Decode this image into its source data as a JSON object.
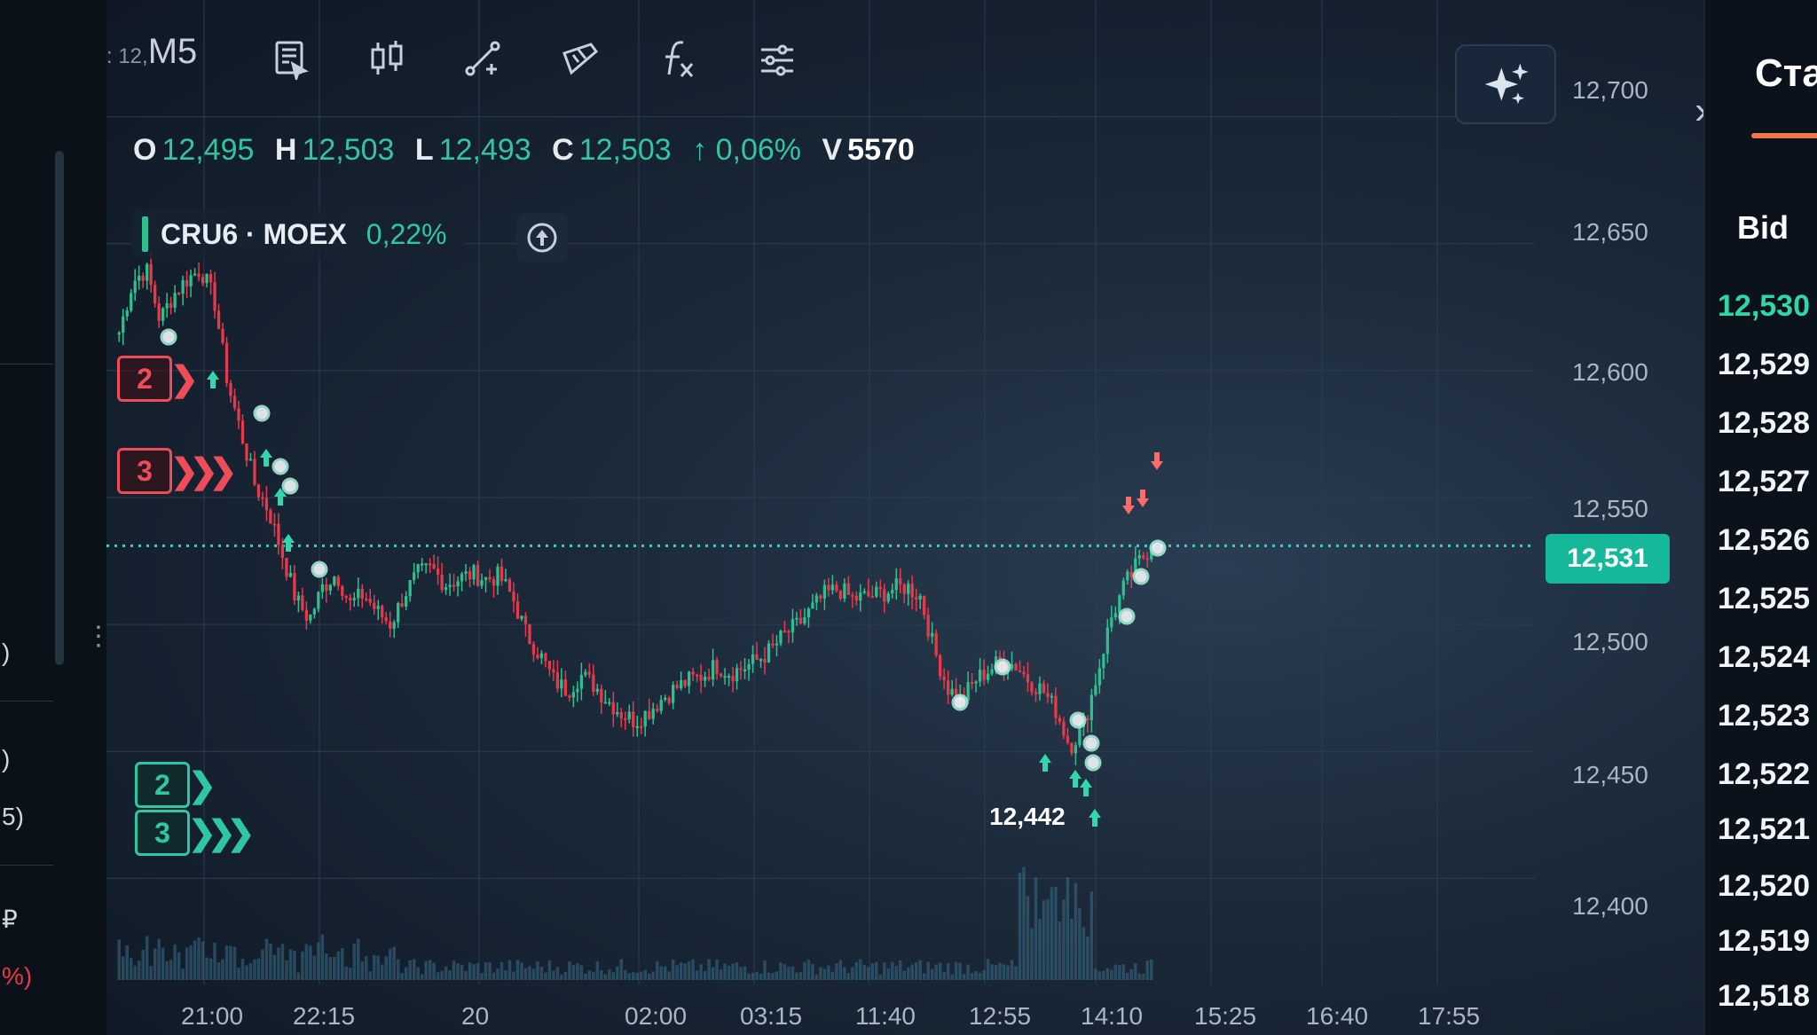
{
  "toolbar": {
    "interval_prefix": ": 12,",
    "interval": "M5",
    "tools": [
      {
        "name": "layout-icon"
      },
      {
        "name": "candles-icon"
      },
      {
        "name": "draw-icon"
      },
      {
        "name": "brush-icon"
      },
      {
        "name": "indicators-icon"
      },
      {
        "name": "settings-icon"
      }
    ],
    "ai_icon": "sparkles-icon"
  },
  "ohlc": {
    "o_label": "O",
    "o": "12,495",
    "h_label": "H",
    "h": "12,503",
    "l_label": "L",
    "l": "12,493",
    "c_label": "C",
    "c": "12,503",
    "change": "↑ 0,06%",
    "v_label": "V",
    "v": "5570"
  },
  "symbol": {
    "name": "CRU6 · MOEX",
    "change": "0,22%"
  },
  "level_tags": {
    "sell": [
      "2",
      "3"
    ],
    "buy": [
      "2",
      "3"
    ]
  },
  "price_axis": {
    "ticks": [
      "12,700",
      "12,650",
      "12,600",
      "12,550",
      "12,500",
      "12,450",
      "12,400"
    ],
    "current_price": "12,531"
  },
  "time_axis": {
    "ticks": [
      "21:00",
      "22:15",
      "20",
      "02:00",
      "03:15",
      "11:40",
      "12:55",
      "14:10",
      "15:25",
      "16:40",
      "17:55"
    ]
  },
  "chart_annotations": {
    "low_label": "12,442"
  },
  "orderbook": {
    "title": "Ста",
    "bid_label": "Bid",
    "rows": [
      "12,530",
      "12,529",
      "12,528",
      "12,527",
      "12,526",
      "12,525",
      "12,524",
      "12,523",
      "12,522",
      "12,521",
      "12,520",
      "12,519",
      "12,518"
    ]
  },
  "left_panel": {
    "fragments": [
      ")",
      ")",
      "5)",
      "₽",
      "%)"
    ]
  },
  "colors": {
    "up": "#2fbf8f",
    "down": "#e8394a",
    "accent": "#16b89a",
    "background": "#1a2838"
  },
  "chart_data": {
    "type": "candlestick",
    "interval": "M5",
    "symbol": "CRU6 · MOEX",
    "current_price": 12531,
    "session_low": 12442,
    "ylim": [
      12390,
      12710
    ],
    "x_tick_labels": [
      "21:00",
      "22:15",
      "20",
      "02:00",
      "03:15",
      "11:40",
      "12:55",
      "14:10",
      "15:25",
      "16:40",
      "17:55"
    ],
    "close_path": [
      12615,
      12635,
      12640,
      12620,
      12630,
      12636,
      12640,
      12628,
      12595,
      12575,
      12555,
      12545,
      12528,
      12510,
      12502,
      12515,
      12520,
      12508,
      12512,
      12505,
      12500,
      12512,
      12520,
      12522,
      12516,
      12518,
      12520,
      12518,
      12519,
      12510,
      12496,
      12488,
      12478,
      12474,
      12480,
      12476,
      12470,
      12465,
      12462,
      12466,
      12471,
      12475,
      12478,
      12480,
      12484,
      12481,
      12483,
      12486,
      12490,
      12496,
      12500,
      12506,
      12512,
      12514,
      12510,
      12511,
      12512,
      12514,
      12515,
      12511,
      12490,
      12475,
      12470,
      12478,
      12482,
      12486,
      12484,
      12478,
      12474,
      12466,
      12452,
      12460,
      12480,
      12502,
      12515,
      12524,
      12531
    ]
  }
}
